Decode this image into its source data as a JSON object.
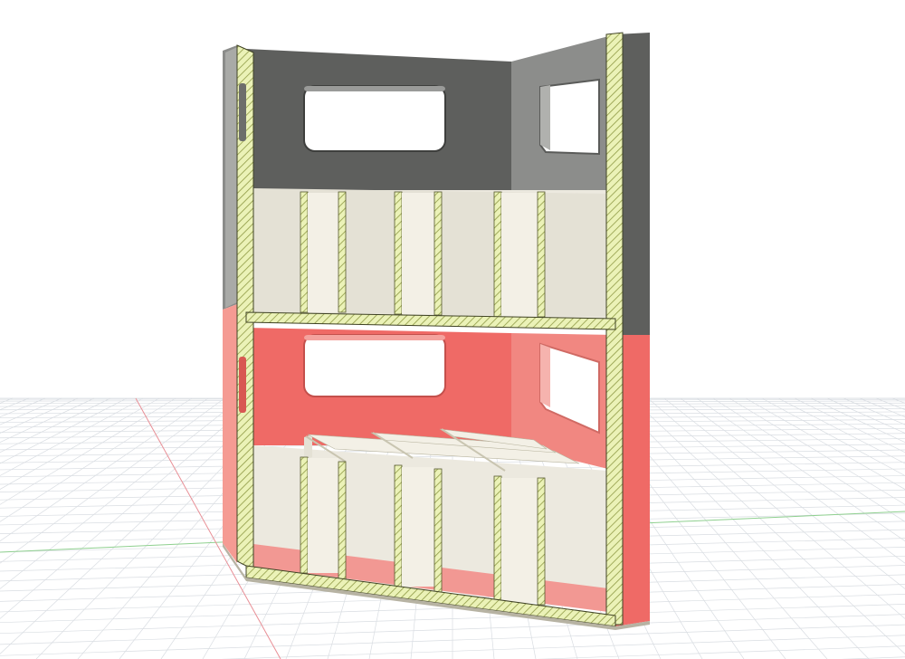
{
  "viewport": {
    "background": "#ffffff",
    "grid_color": "#d9dde2",
    "x_axis_color": "#e88f96",
    "y_axis_color": "#8fd08f"
  },
  "model": {
    "upper_section_color": "#5e5f5d",
    "upper_section_side_color": "#8b8c8a",
    "lower_section_color": "#ef6a66",
    "lower_section_side_color": "#f59b93",
    "interior_color": "#ece9df",
    "section_cut_fill": "#ebf2b7",
    "section_cut_hatch": "#8f9a45",
    "divider_count_upper": 6,
    "divider_count_lower": 6
  }
}
